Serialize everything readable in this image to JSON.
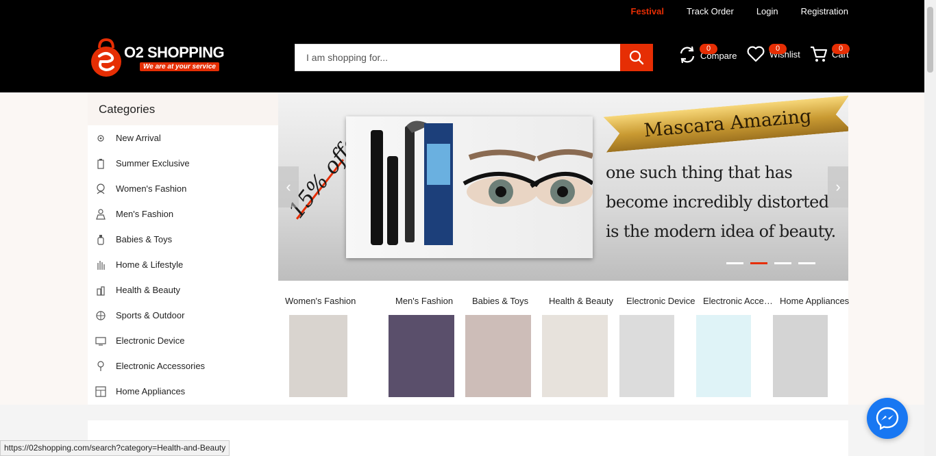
{
  "top_links": {
    "festival": "Festival",
    "track_order": "Track Order",
    "login": "Login",
    "registration": "Registration"
  },
  "logo": {
    "name": "O2 SHOPPING",
    "tagline": "We are at your service"
  },
  "search": {
    "placeholder": "I am shopping for..."
  },
  "header_actions": {
    "compare": {
      "label": "Compare",
      "count": "0"
    },
    "wishlist": {
      "label": "Wishlist",
      "count": "0"
    },
    "cart": {
      "label": "Cart",
      "count": "0"
    }
  },
  "categories": {
    "title": "Categories",
    "items": [
      {
        "label": "New Arrival",
        "icon": "new-arrival-icon"
      },
      {
        "label": "Summer Exclusive",
        "icon": "summer-icon"
      },
      {
        "label": "Women's Fashion",
        "icon": "women-icon"
      },
      {
        "label": "Men's Fashion",
        "icon": "men-icon"
      },
      {
        "label": "Babies & Toys",
        "icon": "baby-bottle-icon"
      },
      {
        "label": "Home & Lifestyle",
        "icon": "hand-icon"
      },
      {
        "label": "Health & Beauty",
        "icon": "beauty-icon"
      },
      {
        "label": "Sports & Outdoor",
        "icon": "sports-icon"
      },
      {
        "label": "Electronic Device",
        "icon": "device-icon"
      },
      {
        "label": "Electronic Accessories",
        "icon": "accessory-icon"
      },
      {
        "label": "Home Appliances",
        "icon": "appliance-icon"
      }
    ]
  },
  "slider": {
    "offer": "15% offer",
    "ribbon": "Mascara Amazing",
    "headline": "one such thing that has become incredibly distorted is the modern idea of beauty.",
    "active_slide": 2,
    "slide_count": 4
  },
  "featured": [
    {
      "label": "Women's Fashion",
      "color": "#d9d4cf"
    },
    {
      "label": "Men's Fashion",
      "color": "#5a4f6b"
    },
    {
      "label": "Babies & Toys",
      "color": "#cdbdb8"
    },
    {
      "label": "Health & Beauty",
      "color": "#e7e2dc"
    },
    {
      "label": "Electronic Device",
      "color": "#dcdcdc"
    },
    {
      "label": "Electronic Accessories",
      "color": "#dff3f7"
    },
    {
      "label": "Home Appliances",
      "color": "#d4d4d4"
    }
  ],
  "status_bar": {
    "url": "https://02shopping.com/search?category=Health-and-Beauty"
  },
  "colors": {
    "brand_red": "#e62e04",
    "header_bg": "#000000",
    "messenger_blue": "#1877f2"
  }
}
